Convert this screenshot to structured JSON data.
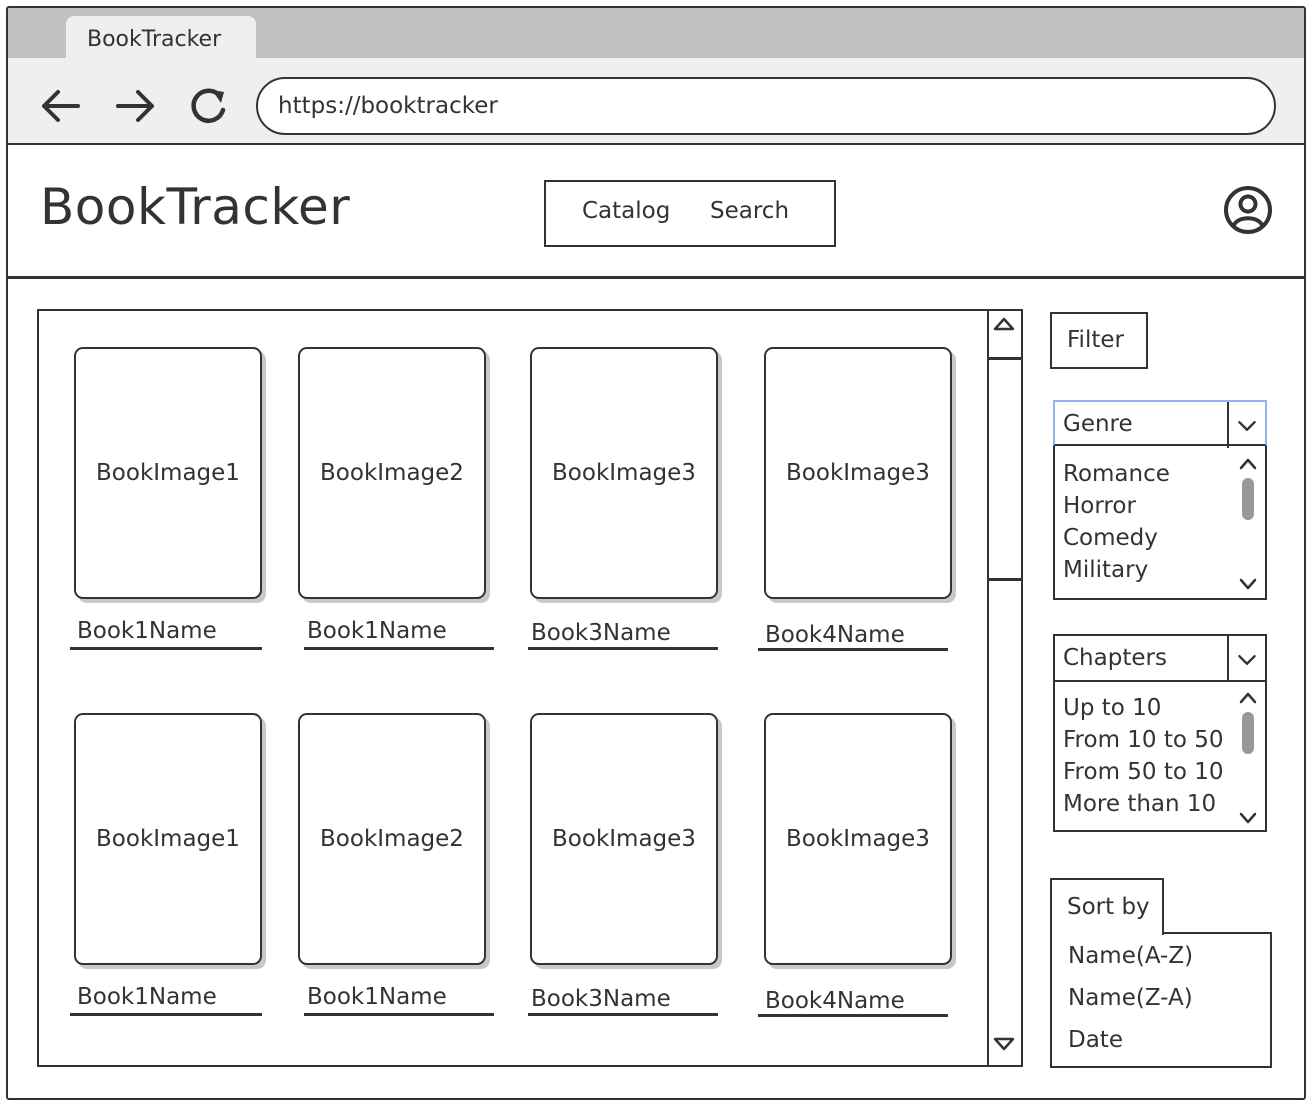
{
  "browser": {
    "tab_title": "BookTracker",
    "url": "https://booktracker",
    "back_icon": "arrow-left-icon",
    "forward_icon": "arrow-right-icon",
    "reload_icon": "reload-icon"
  },
  "header": {
    "logo": "BookTracker",
    "nav": [
      "Catalog",
      "Search"
    ],
    "user_icon": "user-circle-icon"
  },
  "books": [
    {
      "image": "BookImage1",
      "name": "Book1Name"
    },
    {
      "image": "BookImage2",
      "name": "Book1Name"
    },
    {
      "image": "BookImage3",
      "name": "Book3Name"
    },
    {
      "image": "BookImage3",
      "name": "Book4Name"
    },
    {
      "image": "BookImage1",
      "name": "Book1Name"
    },
    {
      "image": "BookImage2",
      "name": "Book1Name"
    },
    {
      "image": "BookImage3",
      "name": "Book3Name"
    },
    {
      "image": "BookImage3",
      "name": "Book4Name"
    }
  ],
  "filter": {
    "button_label": "Filter",
    "genre": {
      "label": "Genre",
      "options": [
        "Romance",
        "Horror",
        "Comedy",
        "Military"
      ]
    },
    "chapters": {
      "label": "Chapters",
      "options": [
        "Up to 10",
        "From 10 to 50",
        "From 50 to 10",
        "More than 10"
      ]
    }
  },
  "sort": {
    "label": "Sort by",
    "options": [
      "Name(A-Z)",
      "Name(Z-A)",
      "Date"
    ]
  }
}
